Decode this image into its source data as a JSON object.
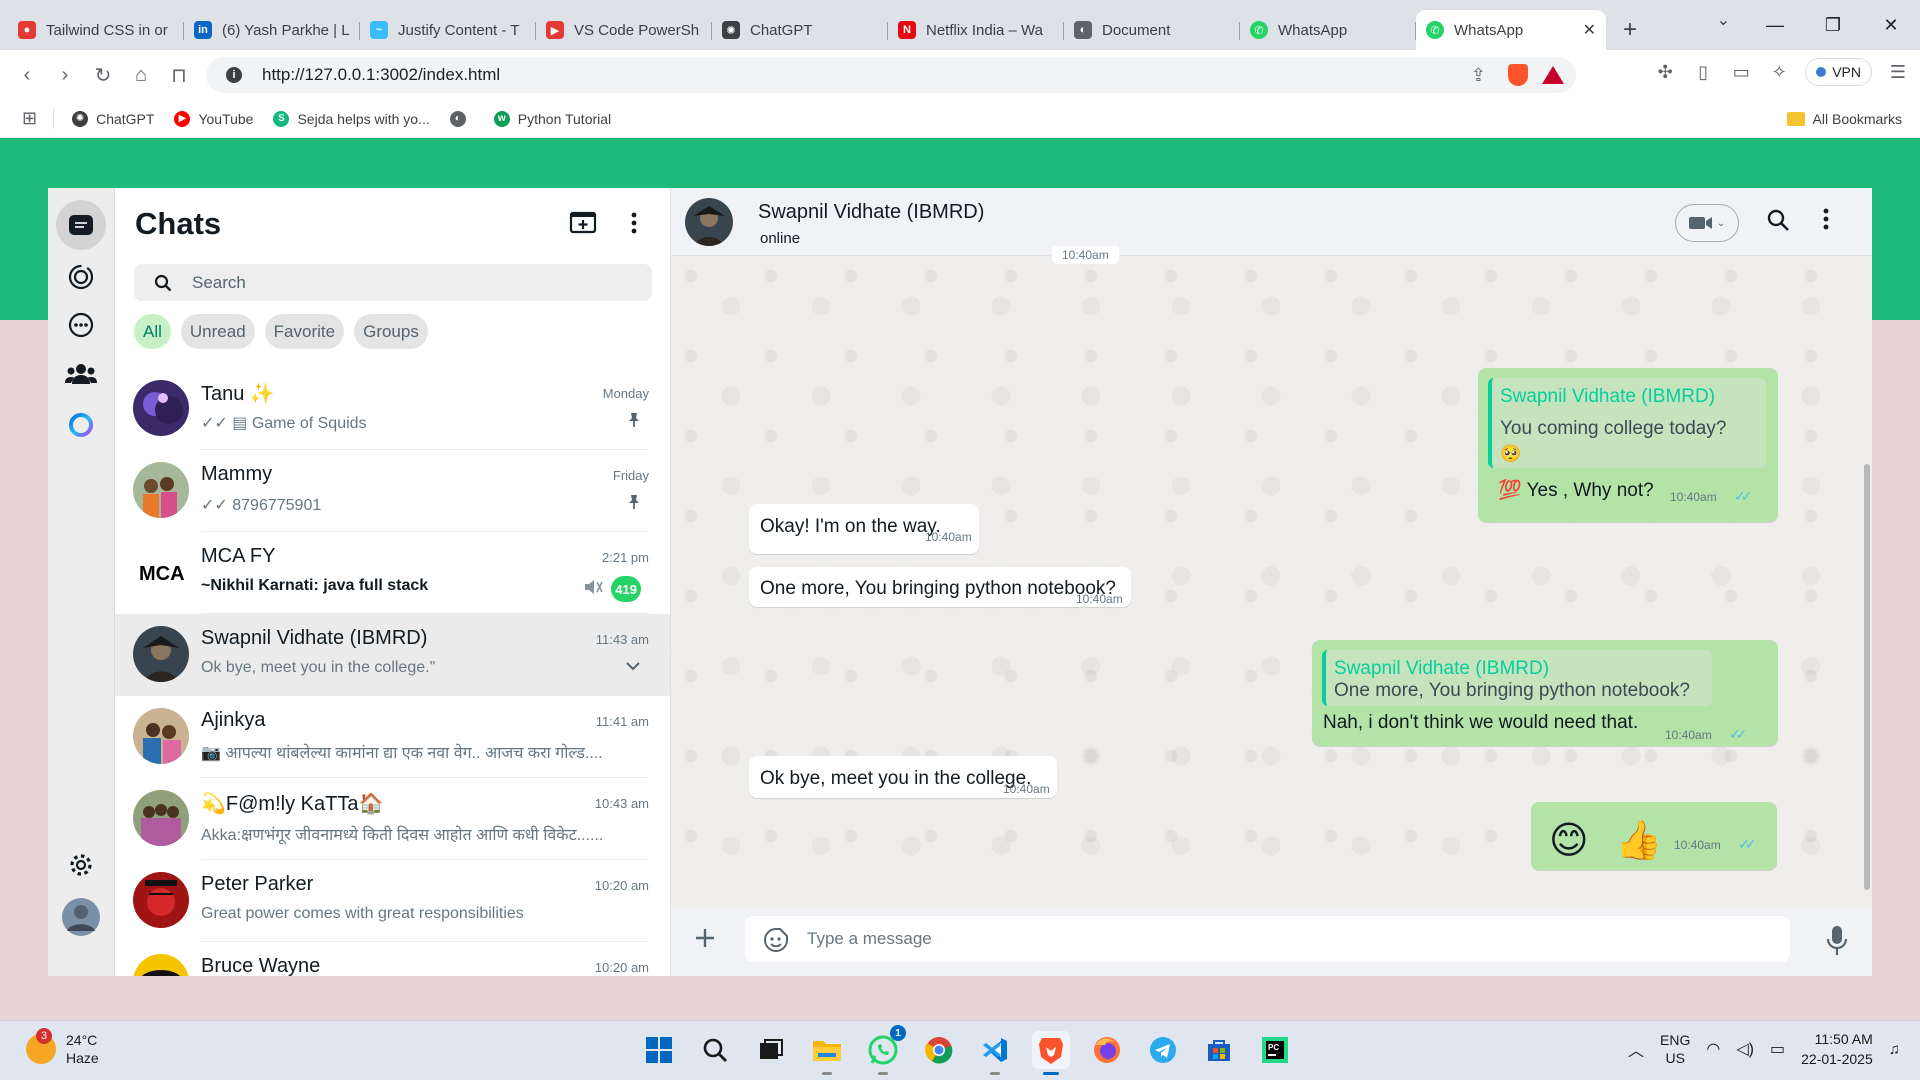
{
  "browser": {
    "tabs": [
      {
        "label": "Tailwind CSS in or",
        "color": "#e53935",
        "glyph": "●"
      },
      {
        "label": "(6) Yash Parkhe | L",
        "color": "#0a66c2",
        "glyph": "in"
      },
      {
        "label": "Justify Content - T",
        "color": "#38bdf8",
        "glyph": "~"
      },
      {
        "label": "VS Code PowerSh",
        "color": "#e53935",
        "glyph": "▶"
      },
      {
        "label": "ChatGPT",
        "color": "#3c4043",
        "glyph": "✺"
      },
      {
        "label": "Netflix India – Wa",
        "color": "#e50914",
        "glyph": "N"
      },
      {
        "label": "Document",
        "color": "#5f6368",
        "glyph": "◐"
      },
      {
        "label": "WhatsApp",
        "color": "#25d366",
        "glyph": "✆"
      }
    ],
    "active_tab": {
      "label": "WhatsApp",
      "color": "#25d366",
      "glyph": "✆"
    },
    "url": "http://127.0.0.1:3002/index.html",
    "vpn_label": "VPN",
    "bookmarks": [
      {
        "label": "ChatGPT",
        "color": "#3c4043",
        "glyph": "✺"
      },
      {
        "label": "YouTube",
        "color": "#ff0000",
        "glyph": "▶"
      },
      {
        "label": "Sejda helps with yo...",
        "color": "#10b981",
        "glyph": "S"
      },
      {
        "label": "",
        "color": "#5f6368",
        "glyph": "◐"
      },
      {
        "label": "Python Tutorial",
        "color": "#0f9d58",
        "glyph": "w"
      }
    ],
    "all_bookmarks": "All Bookmarks"
  },
  "app": {
    "colors": {
      "brand_green": "#1fbb7b",
      "bubble_out": "#b4e3a7",
      "unread_badge": "#25d366"
    },
    "sidebar": {
      "title": "Chats",
      "search_placeholder": "Search",
      "filters": [
        "All",
        "Unread",
        "Favorite",
        "Groups"
      ],
      "chats": [
        {
          "name": "Tanu ✨",
          "time": "Monday",
          "preview": "✓✓ ▤ Game of Squids",
          "pinned": true
        },
        {
          "name": "Mammy",
          "time": "Friday",
          "preview": "✓✓ 8796775901",
          "pinned": true
        },
        {
          "name": "MCA FY",
          "time": "2:21 pm",
          "preview": "~Nikhil Karnati: java full stack",
          "muted": true,
          "unread": "419"
        },
        {
          "name": "Swapnil Vidhate (IBMRD)",
          "time": "11:43 am",
          "preview": "Ok bye, meet you in the college.\""
        },
        {
          "name": "Ajinkya",
          "time": "11:41 am",
          "preview": "📷 आपल्या थांबलेल्या कामांना द्या एक नवा वेग.. आजच करा गोल्ड...."
        },
        {
          "name": "💫F@m!ly KaTTa🏠",
          "time": "10:43 am",
          "preview": "Akka:क्षणभंगूर जीवनामध्ये किती दिवस आहोत आणि कधी विकेट......"
        },
        {
          "name": "Peter Parker",
          "time": "10:20 am",
          "preview": "Great power comes with great responsibilities"
        },
        {
          "name": "Bruce Wayne",
          "time": "10:20 am",
          "preview": ""
        }
      ]
    },
    "conversation": {
      "contact_name": "Swapnil Vidhate (IBMRD)",
      "status": "online",
      "composer_placeholder": "Type a message",
      "messages": [
        {
          "dir": "out",
          "quote_name": "Swapnil Vidhate (IBMRD)",
          "quote_text": "You coming college today?",
          "quote_emoji": "🥺",
          "text": "💯  Yes , Why not?",
          "time": "10:40am"
        },
        {
          "dir": "in",
          "text": "Okay! I'm on the way.",
          "time": "10:40am"
        },
        {
          "dir": "in",
          "text": "One more, You bringing python notebook?",
          "time": "10:40am"
        },
        {
          "dir": "out",
          "quote_name": "Swapnil Vidhate (IBMRD)",
          "quote_text": "One more, You bringing python notebook?",
          "text": "Nah, i don't think we would need that.",
          "time": "10:40am"
        },
        {
          "dir": "in",
          "text": "Ok bye, meet you in the college.",
          "time": "10:40am"
        },
        {
          "dir": "out",
          "text": "😊 👍",
          "time": "10:40am"
        }
      ],
      "partial_top_time": "10:40am"
    }
  },
  "taskbar": {
    "weather_temp": "24°C",
    "weather_desc": "Haze",
    "weather_badge": "3",
    "whatsapp_badge": "1",
    "lang_line1": "ENG",
    "lang_line2": "US",
    "time": "11:50 AM",
    "date": "22-01-2025"
  }
}
